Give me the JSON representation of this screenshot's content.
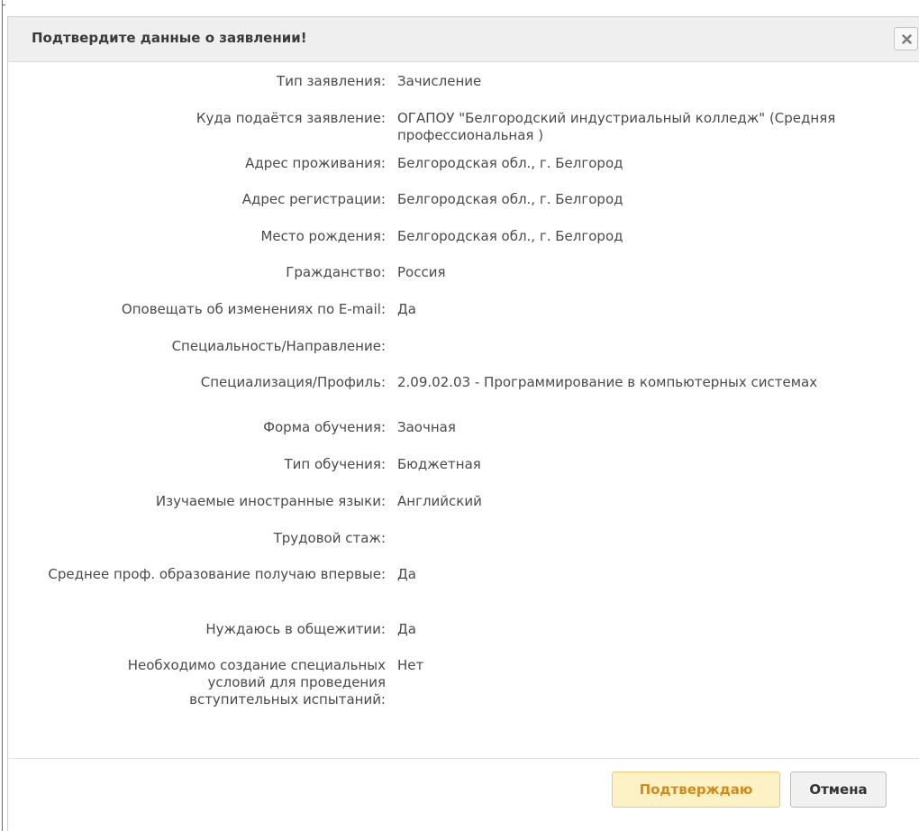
{
  "dialog": {
    "title": "Подтвердите данные о заявлении!",
    "close_icon": "close-icon",
    "rows": [
      {
        "label": "Тип заявления:",
        "value": "Зачисление"
      },
      {
        "label": "Куда подаётся заявление:",
        "value": "ОГАПОУ \"Белгородский индустриальный колледж\" (Средняя профессиональная )"
      },
      {
        "label": "Адрес проживания:",
        "value": "Белгородская обл., г. Белгород"
      },
      {
        "label": "Адрес регистрации:",
        "value": "Белгородская обл., г. Белгород"
      },
      {
        "label": "Место рождения:",
        "value": "Белгородская обл., г. Белгород"
      },
      {
        "label": "Гражданство:",
        "value": "Россия"
      },
      {
        "label": "Оповещать об изменениях по E-mail:",
        "value": "Да"
      },
      {
        "label": "Специальность/Направление:",
        "value": ""
      },
      {
        "label": "Специализация/Профиль:",
        "value": "2.09.02.03 - Программирование в компьютерных системах"
      },
      {
        "label": "Форма обучения:",
        "value": "Заочная"
      },
      {
        "label": "Тип обучения:",
        "value": "Бюджетная"
      },
      {
        "label": "Изучаемые иностранные языки:",
        "value": "Английский"
      },
      {
        "label": "Трудовой стаж:",
        "value": ""
      },
      {
        "label": "Среднее проф. образование получаю впервые:",
        "value": "Да"
      },
      {
        "label": "Нуждаюсь в общежитии:",
        "value": "Да"
      },
      {
        "label": "Необходимо создание специальных условий для проведения вступительных испытаний:",
        "value": "Нет"
      }
    ]
  },
  "footer": {
    "confirm_label": "Подтверждаю",
    "cancel_label": "Отмена"
  },
  "colors": {
    "titlebar_bg": "#efefef",
    "text": "#4a4a4a",
    "confirm_bg": "#fdf1c6",
    "confirm_text": "#d18a1b",
    "cancel_bg": "#f1f1f1"
  }
}
